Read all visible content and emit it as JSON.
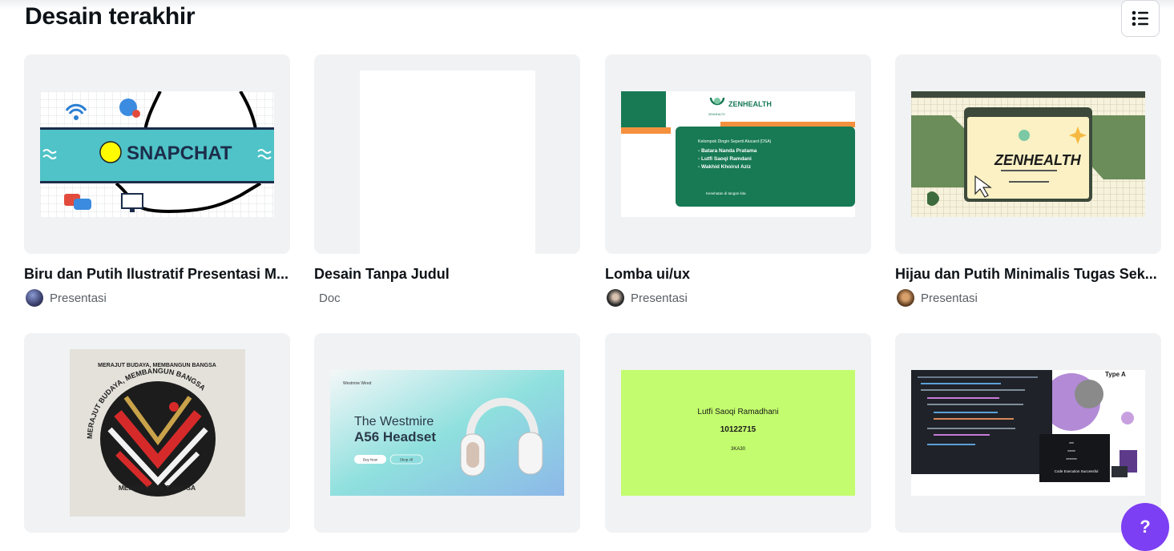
{
  "section_title": "Desain terakhir",
  "designs": [
    {
      "name": "Biru dan Putih Ilustratif Presentasi M...",
      "type": "Presentasi",
      "preview_text": "SNAPCHAT"
    },
    {
      "name": "Desain Tanpa Judul",
      "type": "Doc"
    },
    {
      "name": "Lomba ui/ux",
      "type": "Presentasi",
      "preview": {
        "brand": "ZENHEALTH",
        "brand_sub": "ZENHEALTH",
        "team": "Kelompok Dingin Seperti Alucard (DSA)",
        "members": [
          "- Batara Nanda Pratama",
          "- Lutfi Saoqi Ramdani",
          "- Wakhid Khoirul Aziz"
        ],
        "tagline": "Kesehatan di tangan kita"
      }
    },
    {
      "name": "Hijau dan Putih Minimalis Tugas Sek...",
      "type": "Presentasi",
      "preview_text": "ZENHEALTH"
    },
    {
      "name": "",
      "type": "",
      "preview": {
        "top": "MERAJUT BUDAYA, MEMBANGUN BANGSA",
        "ring": "MERAJUT BUDAYA, MEMBANGUN BANGSA",
        "bottom": "MEMBANGUN BANGSA"
      }
    },
    {
      "name": "",
      "type": "",
      "preview": {
        "brand": "Westmire Wired",
        "headline1": "The Westmire",
        "headline2": "A56 Headset",
        "btn1": "Buy Now",
        "btn2": "Shop All"
      }
    },
    {
      "name": "",
      "type": "",
      "preview": {
        "line1": "Lutfi Saoqi Ramadhani",
        "line2": "10122715",
        "line3": "3KA30"
      }
    },
    {
      "name": "",
      "type": "",
      "preview": {
        "label": "Type A",
        "status": "Code Execution Successful",
        "masked": [
          "***",
          "*****",
          "*******"
        ]
      }
    }
  ],
  "help_label": "?",
  "colors": {
    "accent": "#7d3ff3",
    "thumb_bg": "#f1f2f4",
    "zenhealth_green": "#177a55",
    "lime": "#c3fc6e"
  },
  "icons": {
    "view_toggle": "list-view-icon",
    "help": "help-icon"
  }
}
